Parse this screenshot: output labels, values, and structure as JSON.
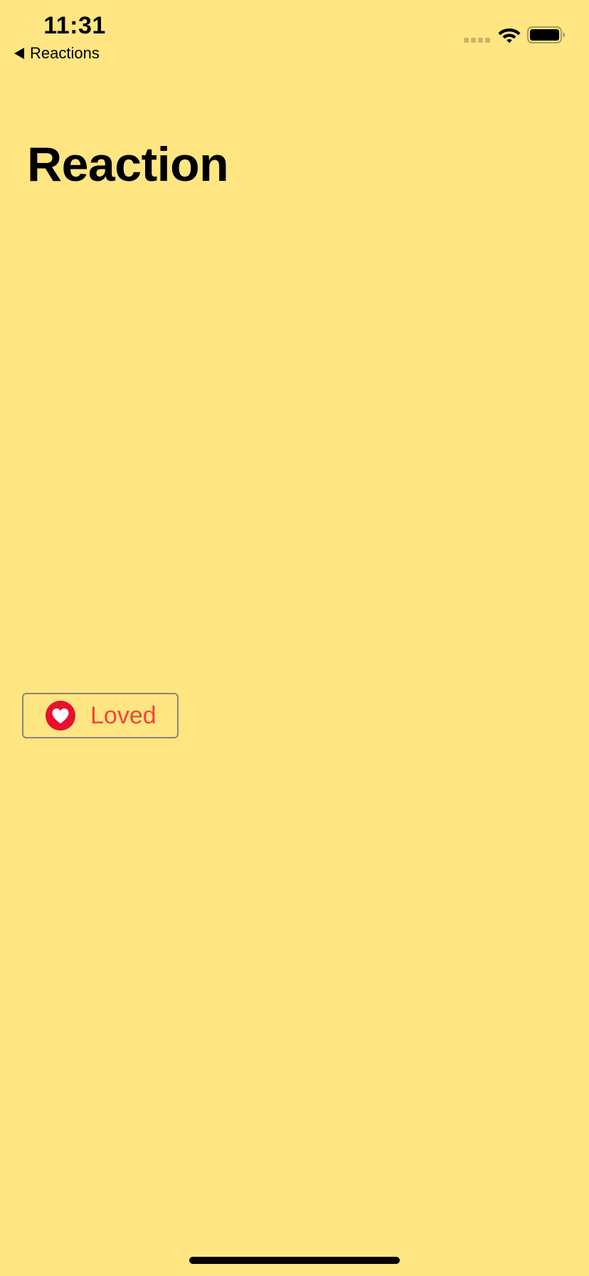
{
  "status_bar": {
    "time": "11:31",
    "signal_icon": "cellular-signal-icon",
    "wifi_icon": "wifi-icon",
    "battery_icon": "battery-icon"
  },
  "navigation": {
    "back_label": "Reactions",
    "back_icon": "back-triangle-icon"
  },
  "page": {
    "title": "Reaction"
  },
  "reaction_button": {
    "label": "Loved",
    "icon": "heart-icon",
    "label_color": "#F1463B",
    "icon_color": "#E8112D"
  },
  "theme": {
    "background": "#FFE682"
  }
}
